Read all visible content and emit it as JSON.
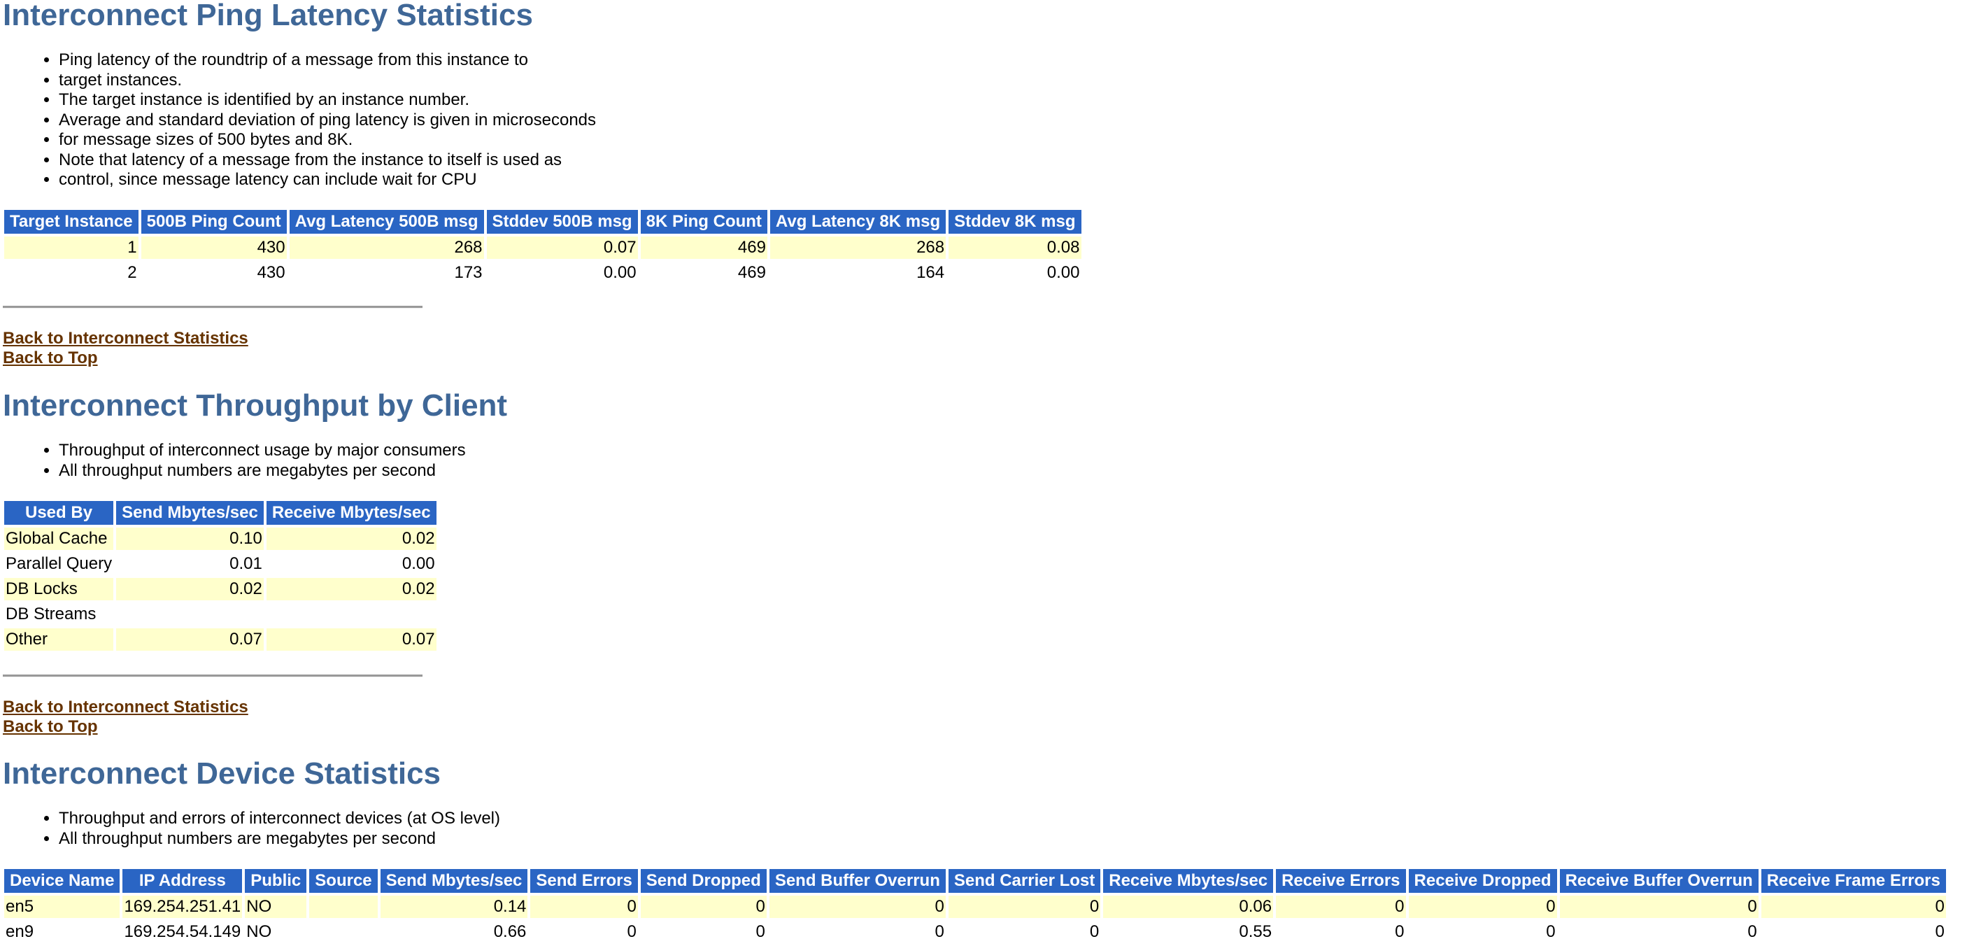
{
  "sections": {
    "ping": {
      "title": "Interconnect Ping Latency Statistics",
      "bullets": [
        "Ping latency of the roundtrip of a message from this instance to",
        "target instances.",
        "The target instance is identified by an instance number.",
        "Average and standard deviation of ping latency is given in microseconds",
        "for message sizes of 500 bytes and 8K.",
        "Note that latency of a message from the instance to itself is used as",
        "control, since message latency can include wait for CPU"
      ],
      "table": {
        "headers": [
          "Target Instance",
          "500B Ping Count",
          "Avg Latency 500B msg",
          "Stddev 500B msg",
          "8K Ping Count",
          "Avg Latency 8K msg",
          "Stddev 8K msg"
        ],
        "rows": [
          [
            "1",
            "430",
            "268",
            "0.07",
            "469",
            "268",
            "0.08"
          ],
          [
            "2",
            "430",
            "173",
            "0.00",
            "469",
            "164",
            "0.00"
          ]
        ]
      }
    },
    "throughput": {
      "title": "Interconnect Throughput by Client",
      "bullets": [
        "Throughput of interconnect usage by major consumers",
        "All throughput numbers are megabytes per second"
      ],
      "table": {
        "headers": [
          "Used By",
          "Send Mbytes/sec",
          "Receive Mbytes/sec"
        ],
        "rows": [
          [
            "Global Cache",
            "0.10",
            "0.02"
          ],
          [
            "Parallel Query",
            "0.01",
            "0.00"
          ],
          [
            "DB Locks",
            "0.02",
            "0.02"
          ],
          [
            "DB Streams",
            "",
            ""
          ],
          [
            "Other",
            "0.07",
            "0.07"
          ]
        ]
      }
    },
    "device": {
      "title": "Interconnect Device Statistics",
      "bullets": [
        "Throughput and errors of interconnect devices (at OS level)",
        "All throughput numbers are megabytes per second"
      ],
      "table": {
        "headers": [
          "Device Name",
          "IP Address",
          "Public",
          "Source",
          "Send Mbytes/sec",
          "Send Errors",
          "Send Dropped",
          "Send Buffer Overrun",
          "Send Carrier Lost",
          "Receive Mbytes/sec",
          "Receive Errors",
          "Receive Dropped",
          "Receive Buffer Overrun",
          "Receive Frame Errors"
        ],
        "rows": [
          [
            "en5",
            "169.254.251.41",
            "NO",
            "",
            "0.14",
            "0",
            "0",
            "0",
            "0",
            "0.06",
            "0",
            "0",
            "0",
            "0"
          ],
          [
            "en9",
            "169.254.54.149",
            "NO",
            "",
            "0.66",
            "0",
            "0",
            "0",
            "0",
            "0.55",
            "0",
            "0",
            "0",
            "0"
          ]
        ]
      }
    }
  },
  "links": {
    "back_to_interconnect": "Back to Interconnect Statistics",
    "back_to_top": "Back to Top"
  },
  "colors": {
    "heading": "#3f6797",
    "table_header_bg": "#2a65c4",
    "row_highlight": "#ffffcc",
    "link": "#663300"
  }
}
